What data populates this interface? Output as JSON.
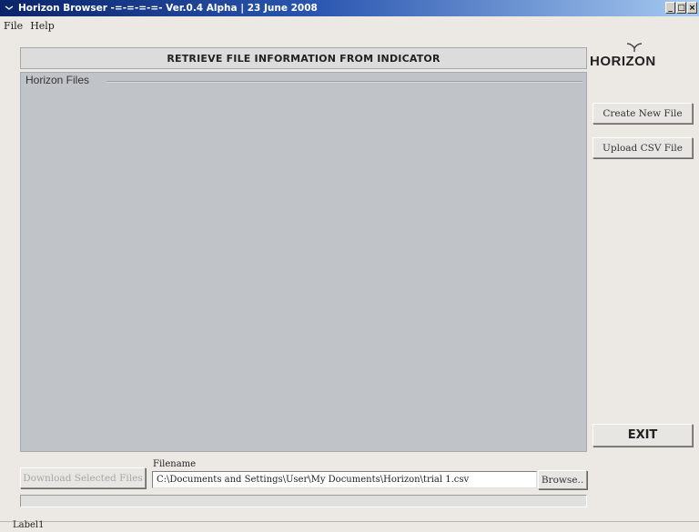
{
  "window": {
    "title": "Horizon Browser -=-=-=-=- Ver.0.4 Alpha | 23 June 2008",
    "controls": {
      "minimize": "_",
      "maximize": "□",
      "close": "×"
    }
  },
  "menu": {
    "items": [
      "File",
      "Help"
    ]
  },
  "header": {
    "title": "RETRIEVE FILE INFORMATION FROM INDICATOR"
  },
  "logo": {
    "text": "HORIZON"
  },
  "files_group": {
    "label": "Horizon Files",
    "items": []
  },
  "buttons": {
    "create_new_file": "Create New File",
    "upload_csv_file": "Upload CSV File",
    "exit": "EXIT",
    "download_selected_files": "Download Selected Files",
    "browse": "Browse.."
  },
  "filename": {
    "label": "Filename",
    "value": "C:\\Documents and Settings\\User\\My Documents\\Horizon\\trial 1.csv"
  },
  "progress": {
    "value": 0
  },
  "status": {
    "text": "Label1"
  },
  "colors": {
    "titlebar_start": "#0a246a",
    "titlebar_end": "#a6caf0",
    "panel_gray": "#c0c4c9",
    "window_bg": "#ece9e4"
  }
}
